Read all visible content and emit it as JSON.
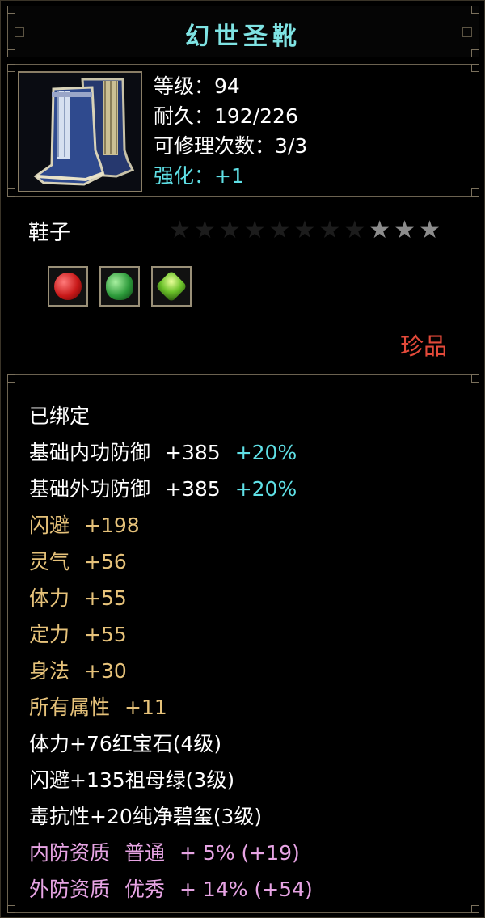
{
  "title": "幻世圣靴",
  "item": {
    "icon": "blue-boots-icon",
    "level": "等级：94",
    "durability": "耐久：192/226",
    "repair": "可修理次数：3/3",
    "enhance": "强化：+1",
    "type": "鞋子",
    "stars_total": 11,
    "stars_lit": 3,
    "rarity": "珍品",
    "rarity_color": "#e34a3a"
  },
  "gems": [
    "ruby-gem-icon",
    "emerald-gem-icon",
    "jade-gem-icon"
  ],
  "properties": {
    "bound": "已绑定",
    "inner_def_label": "基础内功防御",
    "inner_def_value": "+385",
    "inner_def_bonus": "+20%",
    "outer_def_label": "基础外功防御",
    "outer_def_value": "+385",
    "outer_def_bonus": "+20%",
    "dodge_label": "闪避",
    "dodge_value": "+198",
    "spirit_label": "灵气",
    "spirit_value": "+56",
    "stamina_label": "体力",
    "stamina_value": "+55",
    "focus_label": "定力",
    "focus_value": "+55",
    "agility_label": "身法",
    "agility_value": "+30",
    "all_attr_label": "所有属性",
    "all_attr_value": "+11",
    "gem1": "体力+76红宝石(4级)",
    "gem2": "闪避+135祖母绿(3级)",
    "gem3": "毒抗性+20纯净碧玺(3级)",
    "inner_quality_label": "内防资质",
    "inner_quality_grade": "普通",
    "inner_quality_value": "+ 5% (+19)",
    "outer_quality_label": "外防资质",
    "outer_quality_grade": "优秀",
    "outer_quality_value": "+ 14% (+54)"
  }
}
